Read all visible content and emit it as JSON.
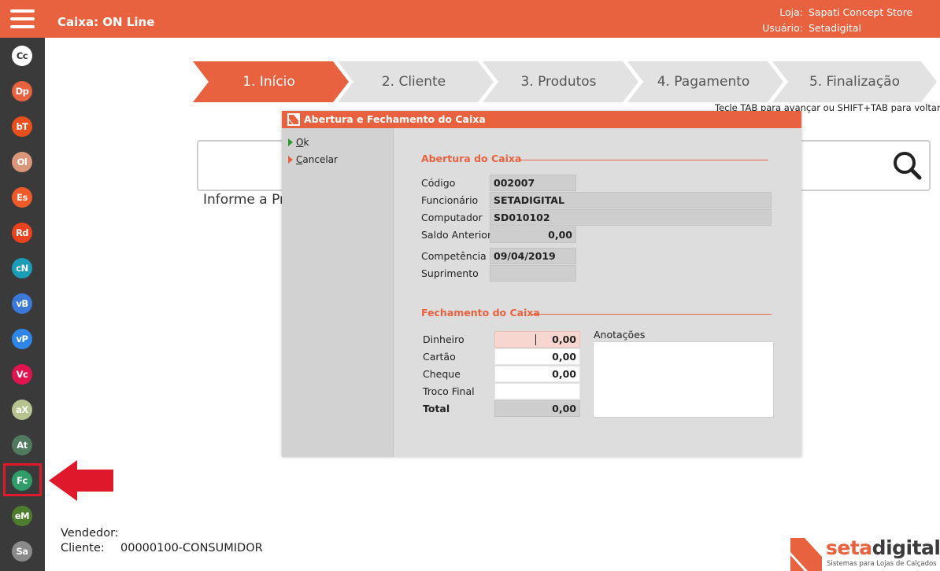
{
  "header": {
    "title": "Caixa: ON Line",
    "store_label": "Loja:",
    "store_value": "Sapati Concept Store",
    "user_label": "Usuário:",
    "user_value": "Setadigital"
  },
  "sidebar": {
    "items": [
      {
        "label": "Cc",
        "color": "#FFFFFF",
        "text_color": "#333333"
      },
      {
        "label": "Dp",
        "color": "#E8623F",
        "text_color": "#FFFFFF"
      },
      {
        "label": "bT",
        "color": "#E8501E",
        "text_color": "#FFFFFF"
      },
      {
        "label": "Ol",
        "color": "#D9967A",
        "text_color": "#FFFFFF"
      },
      {
        "label": "Es",
        "color": "#EF5A28",
        "text_color": "#FFFFFF"
      },
      {
        "label": "Rd",
        "color": "#E8431E",
        "text_color": "#FFFFFF"
      },
      {
        "label": "cN",
        "color": "#1B9DB8",
        "text_color": "#FFFFFF"
      },
      {
        "label": "vB",
        "color": "#3B79D9",
        "text_color": "#FFFFFF"
      },
      {
        "label": "vP",
        "color": "#2F86E8",
        "text_color": "#FFFFFF"
      },
      {
        "label": "Vc",
        "color": "#E0144F",
        "text_color": "#FFFFFF"
      },
      {
        "label": "aX",
        "color": "#B7C38E",
        "text_color": "#FFFFFF"
      },
      {
        "label": "At",
        "color": "#4F7A5E",
        "text_color": "#FFFFFF"
      },
      {
        "label": "Fc",
        "color": "#2F9C69",
        "text_color": "#FFFFFF"
      },
      {
        "label": "eM",
        "color": "#4E7D2E",
        "text_color": "#FFFFFF"
      },
      {
        "label": "Sa",
        "color": "#8A8A8A",
        "text_color": "#FFFFFF"
      }
    ]
  },
  "steps": [
    {
      "label": "1. Início",
      "active": true
    },
    {
      "label": "2. Cliente",
      "active": false
    },
    {
      "label": "3. Produtos",
      "active": false
    },
    {
      "label": "4. Pagamento",
      "active": false
    },
    {
      "label": "5. Finalização",
      "active": false
    }
  ],
  "tab_hint": "Tecle TAB para avançar ou SHIFT+TAB para voltar",
  "search": {
    "hint": "Informe a Pr"
  },
  "footer": {
    "seller_label": "Vendedor:",
    "client_label": "Cliente:",
    "client_value": "00000100-CONSUMIDOR"
  },
  "brand": {
    "name_a": "seta",
    "name_b": "digital",
    "tagline": "Sistemas para Lojas de Calçados"
  },
  "dialog": {
    "title": "Abertura e Fechamento do Caixa",
    "actions": {
      "ok_first": "O",
      "ok_rest": "k",
      "cancel_first": "C",
      "cancel_rest": "ancelar"
    },
    "opening": {
      "section_title": "Abertura do Caixa",
      "codigo_label": "Código",
      "codigo_value": "002007",
      "funcionario_label": "Funcionário",
      "funcionario_value": "SETADIGITAL",
      "computador_label": "Computador",
      "computador_value": "SD010102",
      "saldo_label": "Saldo Anterior",
      "saldo_value": "0,00",
      "competencia_label": "Competência",
      "competencia_value": "09/04/2019",
      "suprimento_label": "Suprimento",
      "suprimento_value": ""
    },
    "closing": {
      "section_title": "Fechamento do Caixa",
      "dinheiro_label": "Dinheiro",
      "dinheiro_value": "0,00",
      "cartao_label": "Cartão",
      "cartao_value": "0,00",
      "cheque_label": "Cheque",
      "cheque_value": "0,00",
      "troco_label": "Troco Final",
      "troco_value": "",
      "total_label": "Total",
      "total_value": "0,00",
      "notes_label": "Anotações"
    }
  },
  "colors": {
    "brand": "#E8623F",
    "sidebar": "#3A3A3A",
    "step_inactive": "#E2E2E2",
    "highlight": "#E0182B"
  }
}
